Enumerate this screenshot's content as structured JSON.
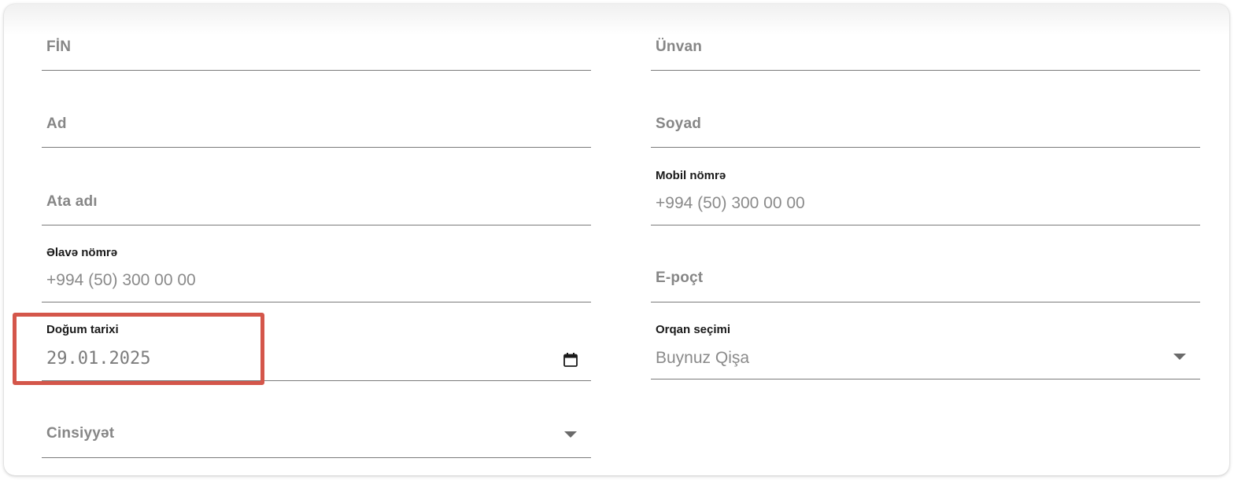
{
  "form": {
    "fin": {
      "placeholder": "FİN"
    },
    "address": {
      "placeholder": "Ünvan"
    },
    "first_name": {
      "placeholder": "Ad"
    },
    "last_name": {
      "placeholder": "Soyad"
    },
    "father_name": {
      "placeholder": "Ata adı"
    },
    "mobile": {
      "label": "Mobil nömrə",
      "value": "+994 (50) 300 00 00"
    },
    "extra_phone": {
      "label": "Əlavə nömrə",
      "value": "+994 (50) 300 00 00"
    },
    "email": {
      "placeholder": "E-poçt"
    },
    "birth_date": {
      "label": "Doğum tarixi",
      "value": "29.01.2025",
      "icon": "calendar-icon"
    },
    "organ": {
      "label": "Orqan seçimi",
      "value": "Buynuz Qişa",
      "icon": "chevron-down-icon"
    },
    "gender": {
      "placeholder": "Cinsiyyət",
      "icon": "chevron-down-icon"
    }
  },
  "colors": {
    "highlight": "#d4564a",
    "underline": "#7a7a7a",
    "placeholder": "#868686"
  }
}
